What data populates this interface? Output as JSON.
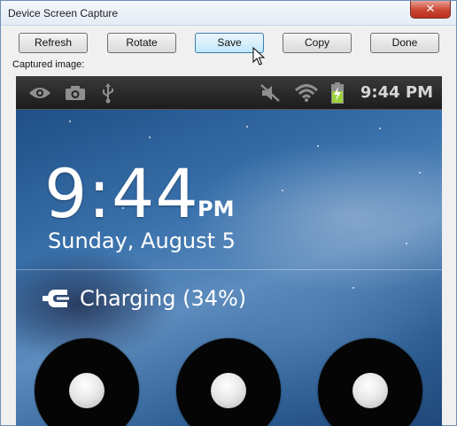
{
  "window": {
    "title": "Device Screen Capture",
    "close_label": "✕"
  },
  "toolbar": {
    "refresh_label": "Refresh",
    "rotate_label": "Rotate",
    "save_label": "Save",
    "copy_label": "Copy",
    "done_label": "Done"
  },
  "captured_label": "Captured image:",
  "device": {
    "statusbar": {
      "time": "9:44 PM",
      "icons": [
        "eye-icon",
        "camera-icon",
        "usb-icon",
        "mute-icon",
        "wifi-icon",
        "battery-charging-icon"
      ]
    },
    "lockscreen": {
      "clock": "9:44",
      "ampm": "PM",
      "date": "Sunday, August 5",
      "charging_text": "Charging (34%)"
    }
  },
  "colors": {
    "battery_fill": "#9bd13b",
    "wallpaper_base": "#2e5f93"
  }
}
